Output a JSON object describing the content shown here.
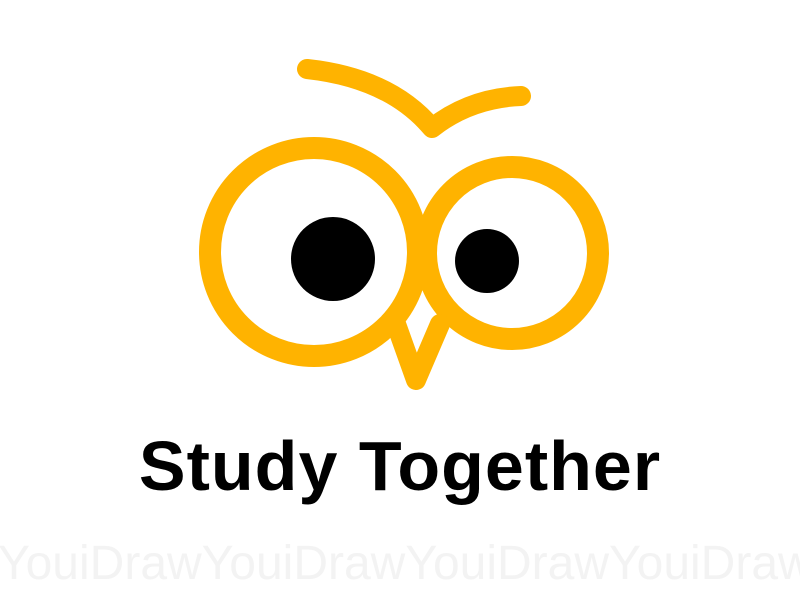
{
  "logo": {
    "wordmark": "Study Together",
    "icon": "owl-face-icon",
    "colors": {
      "accent": "#FFB300",
      "pupil": "#000000",
      "text": "#000000",
      "background": "#FFFFFF",
      "watermark": "#F3F3F3"
    }
  },
  "watermark": {
    "text": "YouiDrawYouiDrawYouiDrawYouiDraw"
  }
}
